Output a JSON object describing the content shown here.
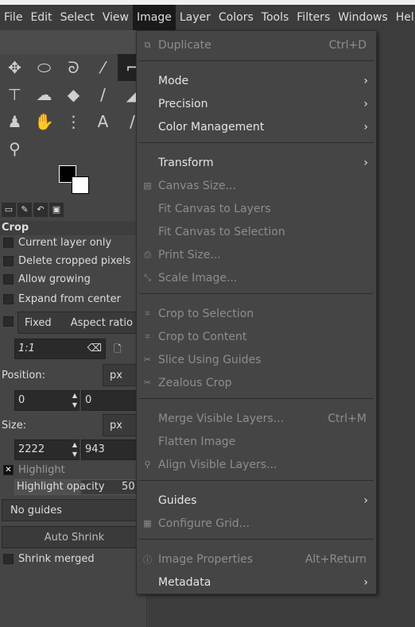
{
  "menubar": [
    "File",
    "Edit",
    "Select",
    "View",
    "Image",
    "Layer",
    "Colors",
    "Tools",
    "Filters",
    "Windows",
    "Help"
  ],
  "menubar_active": "Image",
  "tools": [
    "move-icon",
    "ellipse-select-icon",
    "lasso-icon",
    "fuzzy-select-icon",
    "crop-icon",
    "unified-transform-icon",
    "warp-icon",
    "bucket-fill-icon",
    "paintbrush-icon",
    "eraser-icon",
    "clone-icon",
    "smudge-icon",
    "paths-icon",
    "text-icon",
    "color-picker-icon",
    "zoom-icon"
  ],
  "tool_options": {
    "title": "Crop",
    "current_layer_only": "Current layer only",
    "delete_cropped": "Delete cropped pixels",
    "allow_growing": "Allow growing",
    "expand_from_center": "Expand from center",
    "fixed": "Fixed",
    "aspect_ratio": "Aspect ratio",
    "ratio_value": "1:1",
    "position_label": "Position:",
    "position_unit": "px",
    "pos_x": "0",
    "pos_y": "0",
    "size_label": "Size:",
    "size_unit": "px",
    "size_w": "2222",
    "size_h": "943",
    "highlight": "Highlight",
    "highlight_opacity_label": "Highlight opacity",
    "highlight_opacity": "50.0",
    "guides": "No guides",
    "auto_shrink": "Auto Shrink",
    "shrink_merged": "Shrink merged"
  },
  "image_menu": [
    {
      "label": "Duplicate",
      "shortcut": "Ctrl+D",
      "enabled": false,
      "icon": "duplicate-icon"
    },
    {
      "label": "Mode",
      "enabled": true,
      "submenu": true
    },
    {
      "label": "Precision",
      "enabled": true,
      "submenu": true
    },
    {
      "label": "Color Management",
      "enabled": true,
      "submenu": true
    },
    {
      "label": "Transform",
      "enabled": true,
      "submenu": true
    },
    {
      "label": "Canvas Size...",
      "enabled": false,
      "icon": "canvas-size-icon"
    },
    {
      "label": "Fit Canvas to Layers",
      "enabled": false
    },
    {
      "label": "Fit Canvas to Selection",
      "enabled": false
    },
    {
      "label": "Print Size...",
      "enabled": false,
      "icon": "print-icon"
    },
    {
      "label": "Scale Image...",
      "enabled": false,
      "icon": "scale-icon"
    },
    {
      "label": "Crop to Selection",
      "enabled": false,
      "icon": "crop-icon"
    },
    {
      "label": "Crop to Content",
      "enabled": false,
      "icon": "crop-icon"
    },
    {
      "label": "Slice Using Guides",
      "enabled": false,
      "icon": "slice-icon"
    },
    {
      "label": "Zealous Crop",
      "enabled": false,
      "icon": "zealous-crop-icon"
    },
    {
      "label": "Merge Visible Layers...",
      "shortcut": "Ctrl+M",
      "enabled": false
    },
    {
      "label": "Flatten Image",
      "enabled": false
    },
    {
      "label": "Align Visible Layers...",
      "enabled": false,
      "icon": "align-icon"
    },
    {
      "label": "Guides",
      "enabled": true,
      "submenu": true
    },
    {
      "label": "Configure Grid...",
      "enabled": false,
      "icon": "grid-icon"
    },
    {
      "label": "Image Properties",
      "shortcut": "Alt+Return",
      "enabled": false,
      "icon": "info-icon"
    },
    {
      "label": "Metadata",
      "enabled": true,
      "submenu": true
    }
  ]
}
